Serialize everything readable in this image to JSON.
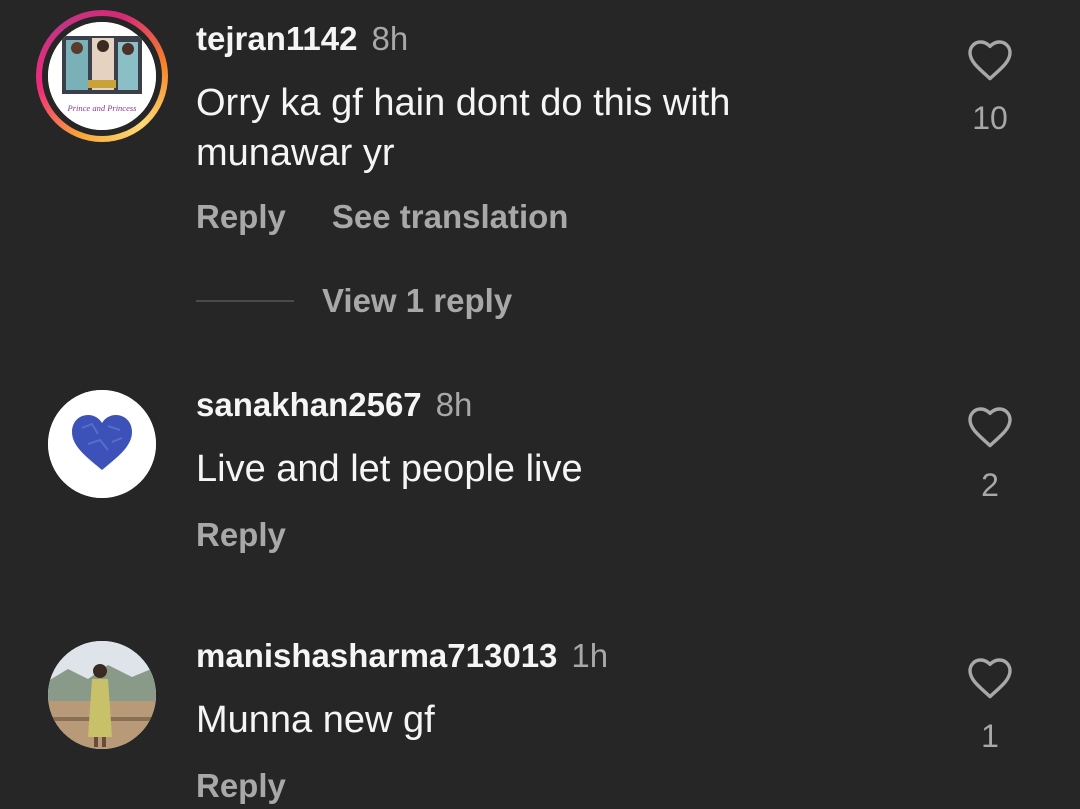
{
  "comments": [
    {
      "username": "tejran1142",
      "time": "8h",
      "text": "Orry ka gf hain dont do this with munawar yr",
      "likes": "10",
      "reply_label": "Reply",
      "translate_label": "See translation",
      "view_replies_label": "View 1 reply",
      "avatar_caption": "Prince and Princess"
    },
    {
      "username": "sanakhan2567",
      "time": "8h",
      "text": "Live and let people live",
      "likes": "2",
      "reply_label": "Reply"
    },
    {
      "username": "manishasharma713013",
      "time": "1h",
      "text": "Munna new gf",
      "likes": "1",
      "reply_label": "Reply"
    }
  ],
  "icons": {
    "like": "heart-outline-icon"
  },
  "colors": {
    "background": "#262626",
    "primary_text": "#f5f5f5",
    "secondary_text": "#a8a8a8",
    "heart_blue": "#3d52b8"
  }
}
